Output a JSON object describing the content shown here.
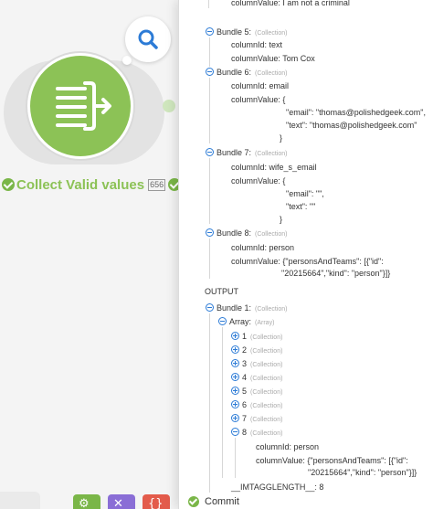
{
  "module": {
    "title": "Collect Valid values",
    "id_badge": "656",
    "icon": "array-aggregator-icon",
    "color": "#8cc256"
  },
  "toolbar": {
    "search_icon": "search-icon",
    "settings_icon": "gear-icon",
    "tools_icon": "tools-icon",
    "flow_icon": "flow-control-icon"
  },
  "inspector": {
    "input_tail": {
      "top_row": {
        "key": "columnValue:",
        "value": "I am not a criminal"
      },
      "bundles": [
        {
          "label": "Bundle 5:",
          "type": "(Collection)",
          "rows": [
            {
              "key": "columnId:",
              "value": "text"
            },
            {
              "key": "columnValue:",
              "value": "Tom Cox"
            }
          ]
        },
        {
          "label": "Bundle 6:",
          "type": "(Collection)",
          "rows": [
            {
              "key": "columnId:",
              "value": "email"
            },
            {
              "key": "columnValue:",
              "value": "{"
            }
          ],
          "json_lines": [
            "\"email\": \"thomas@polishedgeek.com\",",
            "\"text\": \"thomas@polishedgeek.com\""
          ],
          "close": "}"
        },
        {
          "label": "Bundle 7:",
          "type": "(Collection)",
          "rows": [
            {
              "key": "columnId:",
              "value": "wife_s_email"
            },
            {
              "key": "columnValue:",
              "value": "{"
            }
          ],
          "json_lines": [
            "\"email\": \"\",",
            "\"text\": \"\""
          ],
          "close": "}"
        },
        {
          "label": "Bundle 8:",
          "type": "(Collection)",
          "rows": [
            {
              "key": "columnId:",
              "value": "person"
            },
            {
              "key": "columnValue:",
              "value": "{\"personsAndTeams\": [{\"id\":"
            }
          ],
          "continuation": "\"20215664\",\"kind\": \"person\"}]}"
        }
      ]
    },
    "output": {
      "heading": "OUTPUT",
      "bundle_label": "Bundle 1:",
      "bundle_type": "(Collection)",
      "array_label": "Array:",
      "array_type": "(Array)",
      "items": [
        {
          "index": "1",
          "type": "(Collection)"
        },
        {
          "index": "2",
          "type": "(Collection)"
        },
        {
          "index": "3",
          "type": "(Collection)"
        },
        {
          "index": "4",
          "type": "(Collection)"
        },
        {
          "index": "5",
          "type": "(Collection)"
        },
        {
          "index": "6",
          "type": "(Collection)"
        },
        {
          "index": "7",
          "type": "(Collection)"
        },
        {
          "index": "8",
          "type": "(Collection)"
        }
      ],
      "item8_rows": [
        {
          "key": "columnId:",
          "value": "person"
        },
        {
          "key": "columnValue:",
          "value": "{\"personsAndTeams\": [{\"id\":"
        }
      ],
      "item8_continuation": "\"20215664\",\"kind\": \"person\"}]}",
      "length_key": "__IMTAGGLENGTH__:",
      "length_value": "8"
    },
    "commit_label": "Commit"
  },
  "colors": {
    "accent_blue": "#2c7bd6",
    "green": "#7ab648",
    "purple": "#8a6ed6",
    "red": "#e35b4b"
  }
}
